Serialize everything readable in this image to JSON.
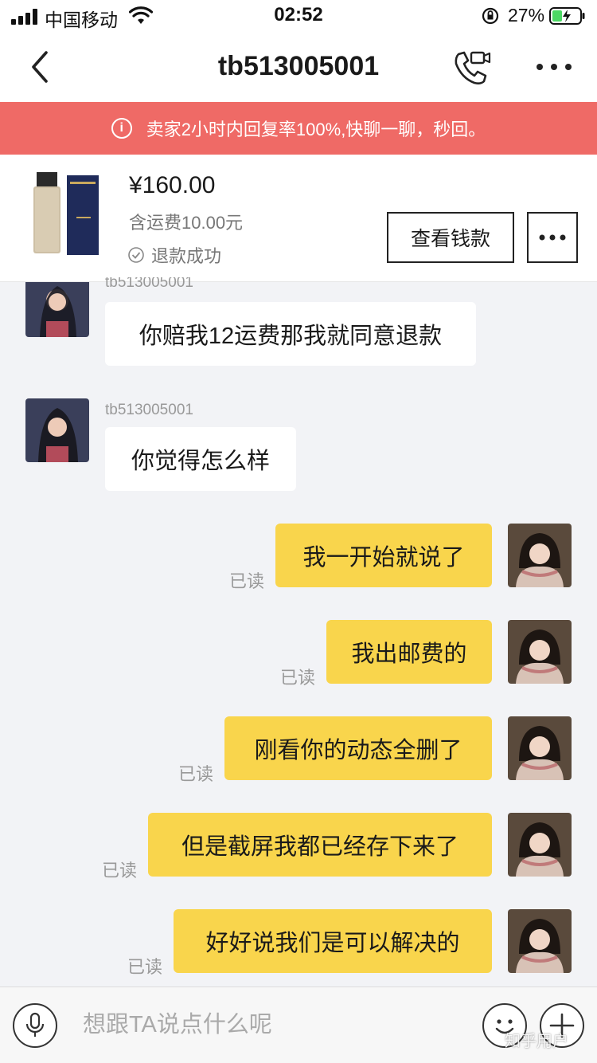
{
  "status_bar": {
    "carrier": "中国移动",
    "time": "02:52",
    "battery_percent": "27%"
  },
  "nav": {
    "title": "tb513005001",
    "icons": [
      "back-icon",
      "video-call-icon",
      "more-icon"
    ]
  },
  "notice": {
    "text": "卖家2小时内回复率100%,快聊一聊，秒回。",
    "icon": "info-icon",
    "color": "#ef6a66"
  },
  "product": {
    "price": "¥160.00",
    "shipping": "含运费10.00元",
    "refund_status": "退款成功",
    "view_button_label": "查看钱款"
  },
  "messages": {
    "incoming": [
      {
        "sender": "tb513005001",
        "text": "你赔我12运费那我就同意退款"
      },
      {
        "sender": "tb513005001",
        "text": "你觉得怎么样"
      }
    ],
    "outgoing": [
      {
        "text": "我一开始就说了",
        "status": "已读"
      },
      {
        "text": "我出邮费的",
        "status": "已读"
      },
      {
        "text": "刚看你的动态全删了",
        "status": "已读"
      },
      {
        "text": "但是截屏我都已经存下来了",
        "status": "已读"
      },
      {
        "text": "好好说我们是可以解决的",
        "status": "已读"
      }
    ]
  },
  "input": {
    "placeholder": "想跟TA说点什么呢"
  },
  "watermark": "知乎用户",
  "colors": {
    "outgoing_bubble": "#f9d54c",
    "incoming_bubble": "#ffffff",
    "background": "#f2f3f6"
  }
}
